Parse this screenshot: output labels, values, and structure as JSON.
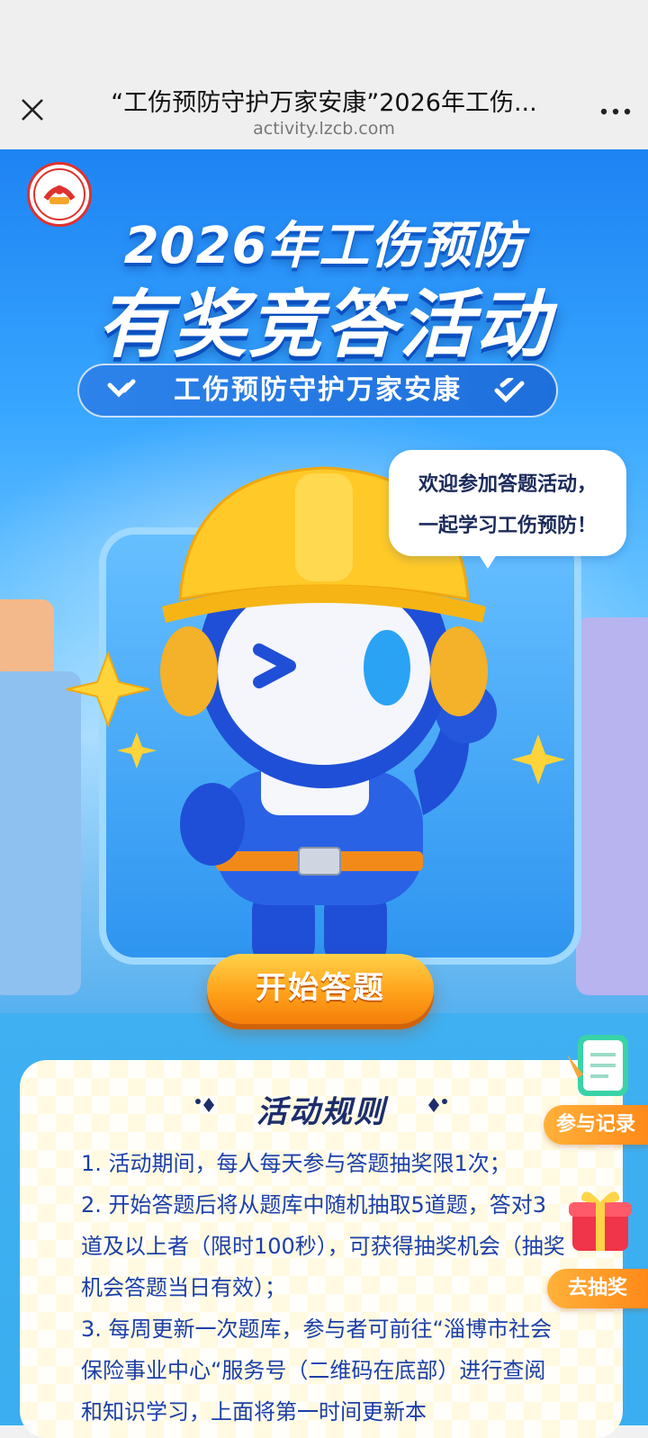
{
  "browser": {
    "title": "“工伤预防守护万家安康”2026年工伤...",
    "url": "activity.lzcb.com"
  },
  "hero": {
    "title_year": "2026年工伤预防",
    "title_main": "有奖竞答活动",
    "slogan": "工伤预防守护万家安康",
    "bubble_line1": "欢迎参加答题活动，",
    "bubble_line2": "一起学习工伤预防！",
    "start_label": "开始答题"
  },
  "rules": {
    "heading": "活动规则",
    "items": [
      "1. 活动期间，每人每天参与答题抽奖限1次；",
      "2. 开始答题后将从题库中随机抽取5道题，答对3道及以上者（限时100秒），可获得抽奖机会（抽奖机会答题当日有效）；",
      "3. 每周更新一次题库，参与者可前往“淄博市社会保险事业中心“服务号（二维码在底部）进行查阅和知识学习，上面将第一时间更新本"
    ]
  },
  "side": {
    "records_label": "参与记录",
    "lottery_label": "去抽奖"
  },
  "colors": {
    "accent_orange": "#ff9a1f",
    "hero_blue": "#1e83f3",
    "rules_text": "#1c3fa8"
  }
}
